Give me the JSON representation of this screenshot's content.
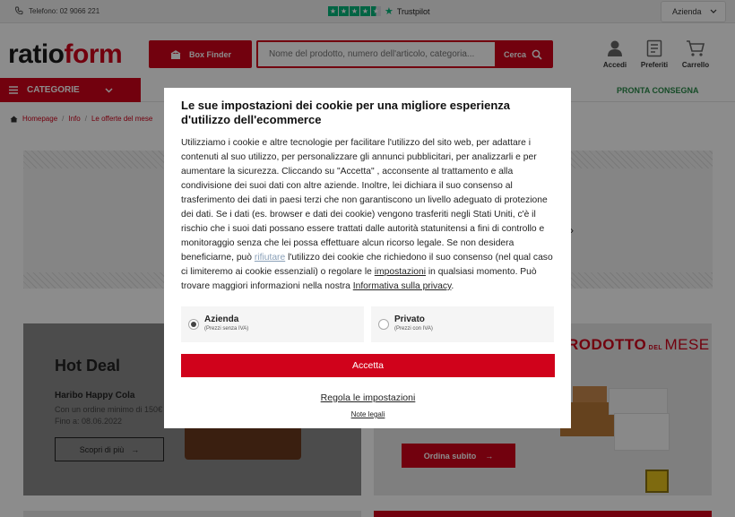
{
  "topbar": {
    "phone": "Telefono: 02 9066 221",
    "trustpilot": "Trustpilot",
    "customer_type_selected": "Azienda"
  },
  "header": {
    "logo_part1": "ratio",
    "logo_part2": "form",
    "box_finder": "Box Finder",
    "search_placeholder": "Nome del prodotto, numero dell'articolo, categoria...",
    "search_button": "Cerca",
    "icons": [
      {
        "label": "Accedi",
        "icon": "user-icon"
      },
      {
        "label": "Preferiti",
        "icon": "wishlist-icon"
      },
      {
        "label": "Carrello",
        "icon": "cart-icon"
      }
    ]
  },
  "nav": {
    "categories": "CATEGORIE",
    "pronta_consegna": "PRONTA CONSEGNA"
  },
  "breadcrumb": [
    "Homepage",
    "Info",
    "Le offerte del mese"
  ],
  "hot_deal": {
    "title": "Hot Deal",
    "product": "Haribo Happy Cola",
    "line1": "Con un ordine minimo di 150€",
    "line2": "Fino a: 08.06.2022",
    "button": "Scopri di più"
  },
  "product_card": {
    "title_part1": "RODOTTO",
    "title_part2": "MESE",
    "button": "Ordina subito"
  },
  "colors": {
    "brand": "#d0021b",
    "trustpilot": "#00b67a",
    "pronta": "#2a8a4a"
  },
  "cookie": {
    "title": "Le sue impostazioni dei cookie per una migliore esperienza d'utilizzo dell'ecommerce",
    "body_1": "Utilizziamo i cookie e altre tecnologie per facilitare l'utilizzo del sito web, per adattare i contenuti al suo utilizzo, per personalizzare gli annunci pubblicitari, per analizzarli e per aumentare la sicurezza. Cliccando su \"Accetta\" , acconsente al trattamento e alla condivisione dei suoi dati con altre aziende. Inoltre, lei dichiara il suo consenso al trasferimento dei dati in paesi terzi che non garantiscono un livello adeguato di protezione dei dati. Se i dati (es. browser e dati dei cookie) vengono trasferiti negli Stati Uniti, c'è il rischio che i suoi dati possano essere trattati dalle autorità statunitensi a fini di controllo e monitoraggio senza che lei possa effettuare alcun ricorso legale. Se non desidera beneficiarne, può ",
    "link_rifiutare": "rifiutare",
    "body_2": " l'utilizzo dei cookie che richiedono il suo consenso (nel qual caso ci limiteremo ai cookie essenziali) o regolare le ",
    "link_impostazioni": "impostazioni",
    "body_3": " in qualsiasi momento. Può trovare maggiori informazioni nella nostra ",
    "link_privacy": "Informativa sulla privacy",
    "body_4": ".",
    "option_business": "Azienda",
    "option_business_sub": "(Prezzi senza IVA)",
    "option_private": "Privato",
    "option_private_sub": "(Prezzi con IVA)",
    "accept": "Accetta",
    "settings": "Regola le impostazioni",
    "legal": "Note legali"
  }
}
